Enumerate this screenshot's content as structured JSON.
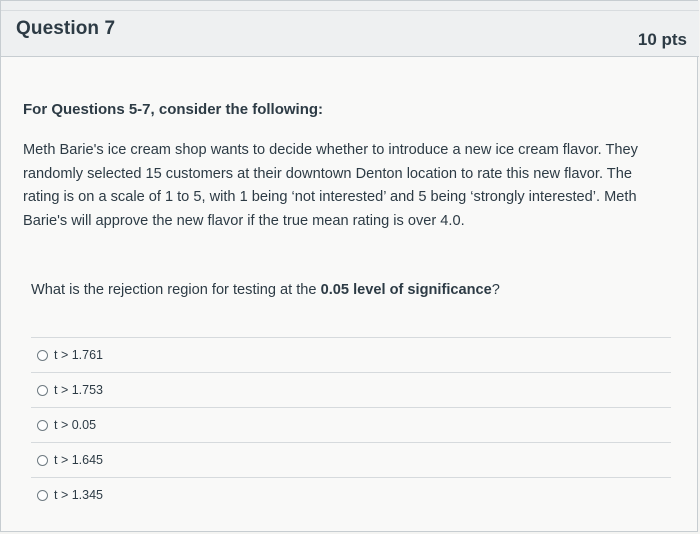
{
  "question": {
    "title": "Question 7",
    "points": "10 pts"
  },
  "intro": {
    "heading": "For Questions 5-7, consider the following:",
    "scenario": "Meth Barie's ice  cream shop wants to decide whether to introduce a new ice cream flavor. They randomly selected 15 customers at their downtown Denton location to rate this new flavor. The rating is on a scale of 1 to 5, with 1 being ‘not interested’ and 5 being ‘strongly interested’. Meth Barie's will approve the new flavor if the true mean rating is over 4.0."
  },
  "prompt": {
    "before": "What is the rejection region for testing at the ",
    "bold": "0.05 level of significance",
    "after": "?"
  },
  "answers": [
    {
      "label": "t > 1.761"
    },
    {
      "label": "t > 1.753"
    },
    {
      "label": "t > 0.05"
    },
    {
      "label": "t > 1.645"
    },
    {
      "label": "t > 1.345"
    }
  ]
}
